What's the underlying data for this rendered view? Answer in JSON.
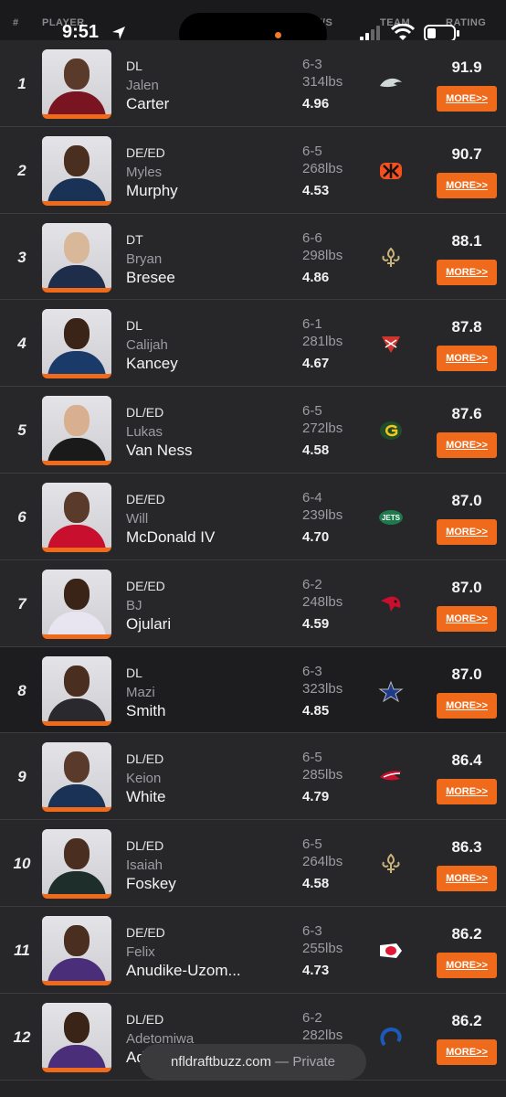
{
  "header": {
    "col_rank": "#",
    "col_player": "PLAYER",
    "col_hws": "H/W/S",
    "col_team": "TEAM",
    "col_rating": "RATING"
  },
  "status": {
    "time": "9:51"
  },
  "players": [
    {
      "rank": "1",
      "pos": "DL",
      "first": "Jalen",
      "last": "Carter",
      "height": "6-3",
      "weight": "314lbs",
      "speed": "4.96",
      "team": "eagles",
      "rating": "91.9",
      "more": "MORE>>"
    },
    {
      "rank": "2",
      "pos": "DE/ED",
      "first": "Myles",
      "last": "Murphy",
      "height": "6-5",
      "weight": "268lbs",
      "speed": "4.53",
      "team": "bengals",
      "rating": "90.7",
      "more": "MORE>>"
    },
    {
      "rank": "3",
      "pos": "DT",
      "first": "Bryan",
      "last": "Bresee",
      "height": "6-6",
      "weight": "298lbs",
      "speed": "4.86",
      "team": "saints",
      "rating": "88.1",
      "more": "MORE>>"
    },
    {
      "rank": "4",
      "pos": "DL",
      "first": "Calijah",
      "last": "Kancey",
      "height": "6-1",
      "weight": "281lbs",
      "speed": "4.67",
      "team": "buccaneers",
      "rating": "87.8",
      "more": "MORE>>"
    },
    {
      "rank": "5",
      "pos": "DL/ED",
      "first": "Lukas",
      "last": "Van Ness",
      "height": "6-5",
      "weight": "272lbs",
      "speed": "4.58",
      "team": "packers",
      "rating": "87.6",
      "more": "MORE>>"
    },
    {
      "rank": "6",
      "pos": "DE/ED",
      "first": "Will",
      "last": "McDonald IV",
      "height": "6-4",
      "weight": "239lbs",
      "speed": "4.70",
      "team": "jets",
      "rating": "87.0",
      "more": "MORE>>"
    },
    {
      "rank": "7",
      "pos": "DE/ED",
      "first": "BJ",
      "last": "Ojulari",
      "height": "6-2",
      "weight": "248lbs",
      "speed": "4.59",
      "team": "cardinals",
      "rating": "87.0",
      "more": "MORE>>"
    },
    {
      "rank": "8",
      "pos": "DL",
      "first": "Mazi",
      "last": "Smith",
      "height": "6-3",
      "weight": "323lbs",
      "speed": "4.85",
      "team": "cowboys",
      "rating": "87.0",
      "more": "MORE>>"
    },
    {
      "rank": "9",
      "pos": "DL/ED",
      "first": "Keion",
      "last": "White",
      "height": "6-5",
      "weight": "285lbs",
      "speed": "4.79",
      "team": "patriots",
      "rating": "86.4",
      "more": "MORE>>"
    },
    {
      "rank": "10",
      "pos": "DL/ED",
      "first": "Isaiah",
      "last": "Foskey",
      "height": "6-5",
      "weight": "264lbs",
      "speed": "4.58",
      "team": "saints",
      "rating": "86.3",
      "more": "MORE>>"
    },
    {
      "rank": "11",
      "pos": "DE/ED",
      "first": "Felix",
      "last": "Anudike-Uzom...",
      "height": "6-3",
      "weight": "255lbs",
      "speed": "4.73",
      "team": "chiefs",
      "rating": "86.2",
      "more": "MORE>>"
    },
    {
      "rank": "12",
      "pos": "DL/ED",
      "first": "Adetomiwa",
      "last": "Ad...",
      "height": "6-2",
      "weight": "282lbs",
      "speed": "",
      "team": "colts",
      "rating": "86.2",
      "more": "MORE>>"
    }
  ],
  "urlbar": {
    "domain": "nfldraftbuzz.com",
    "suffix": " — Private"
  },
  "colors": {
    "accent": "#f06a1c",
    "row_bg": "#27272a",
    "highlight_row_bg": "#1d1d1f"
  }
}
